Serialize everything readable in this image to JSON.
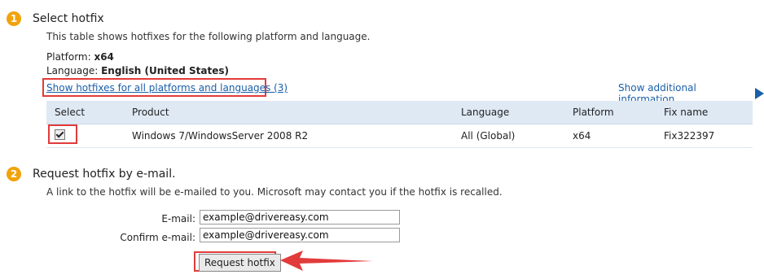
{
  "section1": {
    "step": "1",
    "title": "Select hotfix",
    "description": "This table shows hotfixes for the following platform and language.",
    "platform_label": "Platform: ",
    "platform_value": "x64",
    "language_label": "Language: ",
    "language_value": "English (United States)",
    "show_all_link": "Show hotfixes for all platforms and languages (3)",
    "additional_info_link": "Show additional information"
  },
  "table": {
    "headers": [
      "Select",
      "Product",
      "Language",
      "Platform",
      "Fix name"
    ],
    "rows": [
      {
        "selected": true,
        "product": "Windows 7/WindowsServer 2008 R2",
        "language": "All (Global)",
        "platform": "x64",
        "fix_name": "Fix322397"
      }
    ]
  },
  "section2": {
    "step": "2",
    "title": "Request hotfix by e-mail.",
    "description": "A link to the hotfix will be e-mailed to you. Microsoft may contact you if the hotfix is recalled.",
    "email_label": "E-mail:",
    "email_value": "example@drivereasy.com",
    "confirm_label": "Confirm e-mail:",
    "confirm_value": "example@drivereasy.com",
    "request_button": "Request hotfix"
  },
  "colors": {
    "badge": "#f0a30a",
    "link": "#1a5fa8",
    "highlight": "#e23b3b",
    "table_header": "#dfe9f4"
  },
  "icons": [
    "triangle-right-icon",
    "checkbox-icon",
    "red-arrow-icon"
  ]
}
